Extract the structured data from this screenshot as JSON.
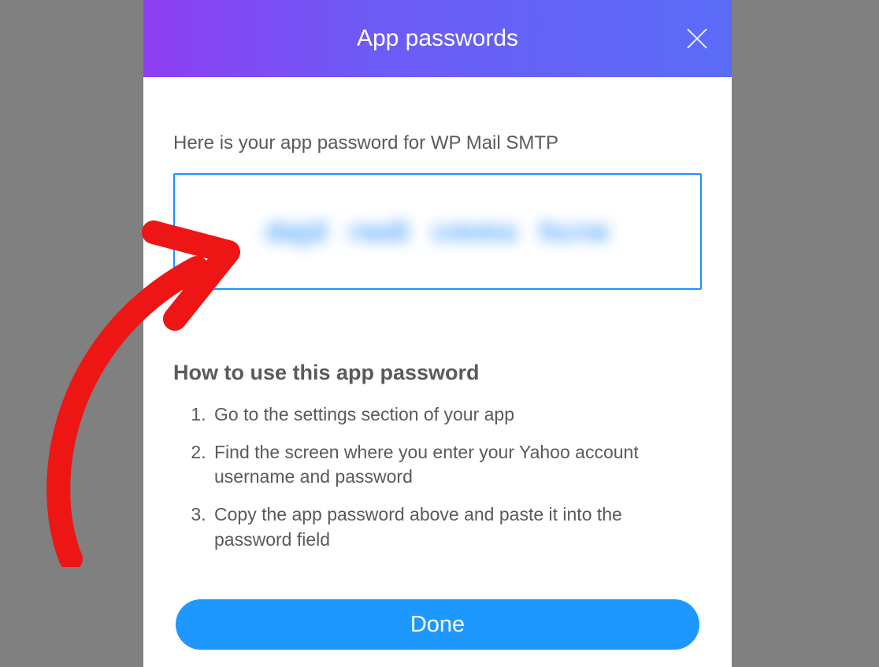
{
  "modal": {
    "title": "App passwords",
    "intro": "Here is your app password for WP Mail SMTP",
    "password": {
      "chunk1": "dajd",
      "chunk2": "rwdi",
      "chunk3": "cmms",
      "chunk4": "hcrw"
    },
    "howto_title": "How to use this app password",
    "steps": [
      "Go to the settings section of your app",
      "Find the screen where you enter your Yahoo account username and password",
      "Copy the app password above and paste it into the password field"
    ],
    "done_label": "Done"
  }
}
